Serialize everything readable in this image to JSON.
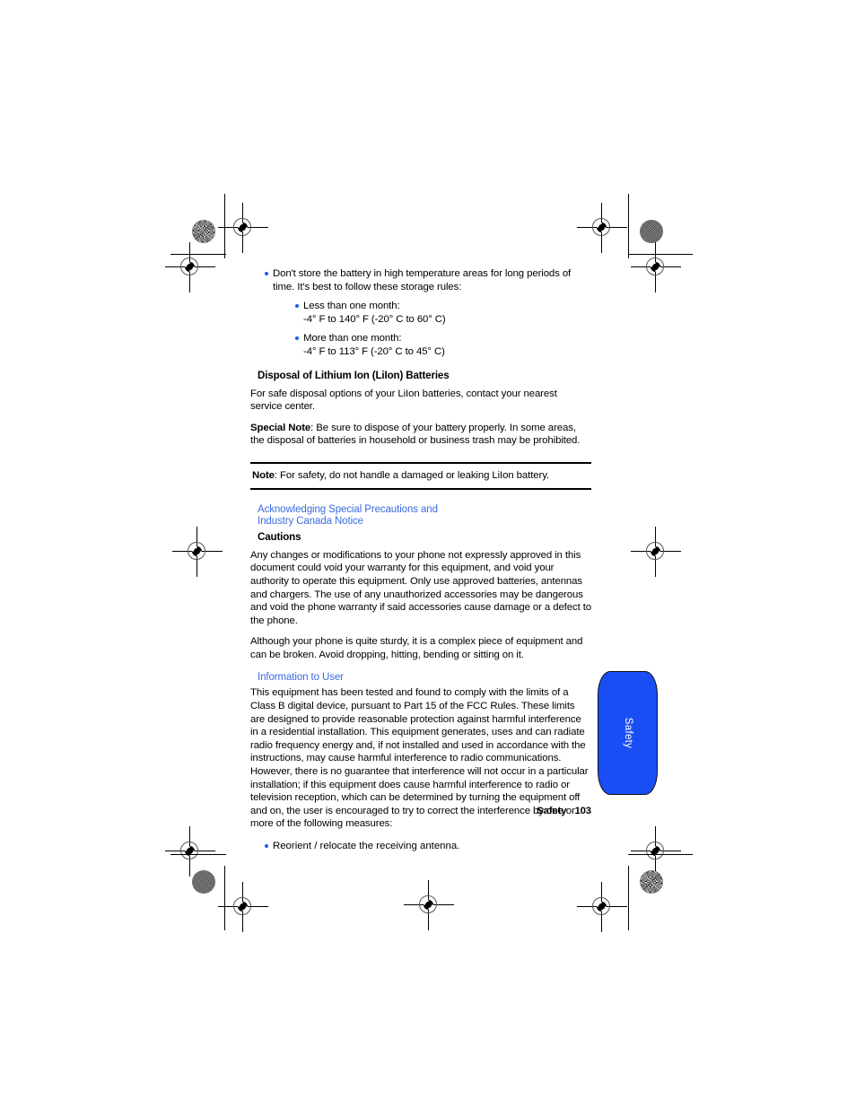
{
  "page": {
    "footer_section": "Safety",
    "footer_page_number": "103",
    "side_tab_label": "Safety",
    "accent_blue": "#3a6be0",
    "bullet_blue": "#1a5cf0",
    "tab_blue": "#1a4ef5"
  },
  "content": {
    "battery_storage": {
      "bullet": "Don't store the battery in high temperature areas for long periods of time. It's best to follow these storage rules:",
      "sub_bullets": [
        {
          "title": "Less than one month:",
          "range": "-4° F to 140° F (-20° C to 60° C)"
        },
        {
          "title": "More than one month:",
          "range": "-4° F to 113° F (-20° C to 45° C)"
        }
      ]
    },
    "disposal": {
      "heading": "Disposal of Lithium Ion (LiIon) Batteries",
      "paragraph": "For safe disposal options of your LiIon batteries, contact your nearest service center.",
      "special_note_label": "Special Note",
      "special_note_body": ": Be sure to dispose of your battery properly. In some areas, the disposal of batteries in household or business trash may be prohibited."
    },
    "note": {
      "label": "Note",
      "body": ": For safety, do not handle a damaged or leaking LiIon battery."
    },
    "acknowledging": {
      "heading_line1": "Acknowledging Special Precautions and",
      "heading_line2": "Industry Canada Notice",
      "cautions_heading": "Cautions",
      "paragraph1": "Any changes or modifications to your phone not expressly approved in this document could void your warranty for this equipment, and void your authority to operate this equipment. Only use approved batteries, antennas and chargers. The use of any unauthorized accessories may be dangerous and void the phone warranty if said accessories cause damage or a defect to the phone.",
      "paragraph2": "Although your phone is quite sturdy, it is a complex piece of equipment and can be broken. Avoid dropping, hitting, bending or sitting on it."
    },
    "information_to_user": {
      "heading": "Information to User",
      "paragraph": "This equipment has been tested and found to comply with the limits of a Class B digital device, pursuant to Part 15 of the FCC Rules. These limits are designed to provide reasonable protection against harmful interference in a residential installation. This equipment generates, uses and can radiate radio frequency energy and, if not installed and used in accordance with the instructions, may cause harmful interference to radio communications. However, there is no guarantee that interference will not occur in a particular installation; if this equipment does cause harmful interference to radio or television reception, which can be determined by turning the equipment off and on, the user is encouraged to try to correct the interference by one or more of the following measures:",
      "measure1": "Reorient / relocate the receiving antenna."
    }
  }
}
